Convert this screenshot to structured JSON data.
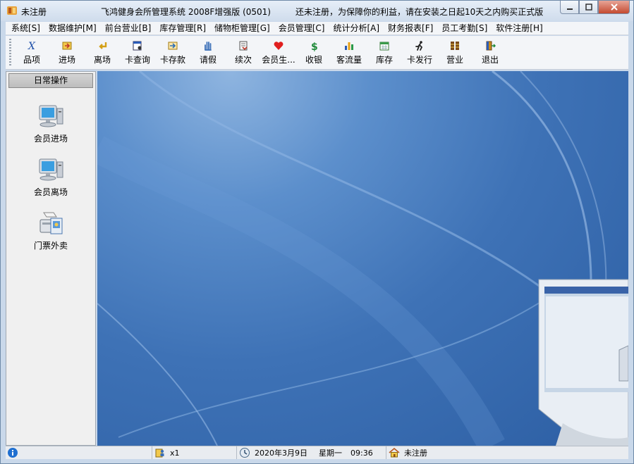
{
  "title": {
    "left_text": "未注册",
    "app_name": "飞鸿健身会所管理系统  2008F增强版 (0501)",
    "notice": "还未注册，为保障你的利益，请在安装之日起10天之内购买正式版"
  },
  "menu": [
    {
      "label": "系统[S]"
    },
    {
      "label": "数据维护[M]"
    },
    {
      "label": "前台营业[B]"
    },
    {
      "label": "库存管理[R]"
    },
    {
      "label": "储物柜管理[G]"
    },
    {
      "label": "会员管理[C]"
    },
    {
      "label": "统计分析[A]"
    },
    {
      "label": "财务报表[F]"
    },
    {
      "label": "员工考勤[S]"
    },
    {
      "label": "软件注册[H]"
    }
  ],
  "toolbar": [
    {
      "label": "品项",
      "icon": "item-icon"
    },
    {
      "label": "进场",
      "icon": "enter-icon"
    },
    {
      "label": "离场",
      "icon": "exit-arrow-icon"
    },
    {
      "label": "卡查询",
      "icon": "card-search-icon"
    },
    {
      "label": "卡存款",
      "icon": "card-deposit-icon"
    },
    {
      "label": "请假",
      "icon": "leave-hand-icon"
    },
    {
      "label": "续次",
      "icon": "renew-icon"
    },
    {
      "label": "会员生...",
      "icon": "heart-icon"
    },
    {
      "label": "收银",
      "icon": "dollar-icon"
    },
    {
      "label": "客流量",
      "icon": "bar-chart-icon"
    },
    {
      "label": "库存",
      "icon": "calendar-icon"
    },
    {
      "label": "卡发行",
      "icon": "runner-icon"
    },
    {
      "label": "营业",
      "icon": "business-icon"
    },
    {
      "label": "退出",
      "icon": "door-exit-icon"
    }
  ],
  "panel": {
    "header": "日常操作",
    "shortcuts": [
      {
        "label": "会员进场",
        "icon": "computer-icon"
      },
      {
        "label": "会员离场",
        "icon": "computer-icon"
      },
      {
        "label": "门票外卖",
        "icon": "printer-icon"
      }
    ]
  },
  "status": {
    "count": "x1",
    "date": "2020年3月9日",
    "weekday": "星期一",
    "time": "09:36",
    "register": "未注册"
  },
  "colors": {
    "desktop": "#3e72b6",
    "titlebar": "#dce6f2",
    "close_button": "#c44a30"
  }
}
